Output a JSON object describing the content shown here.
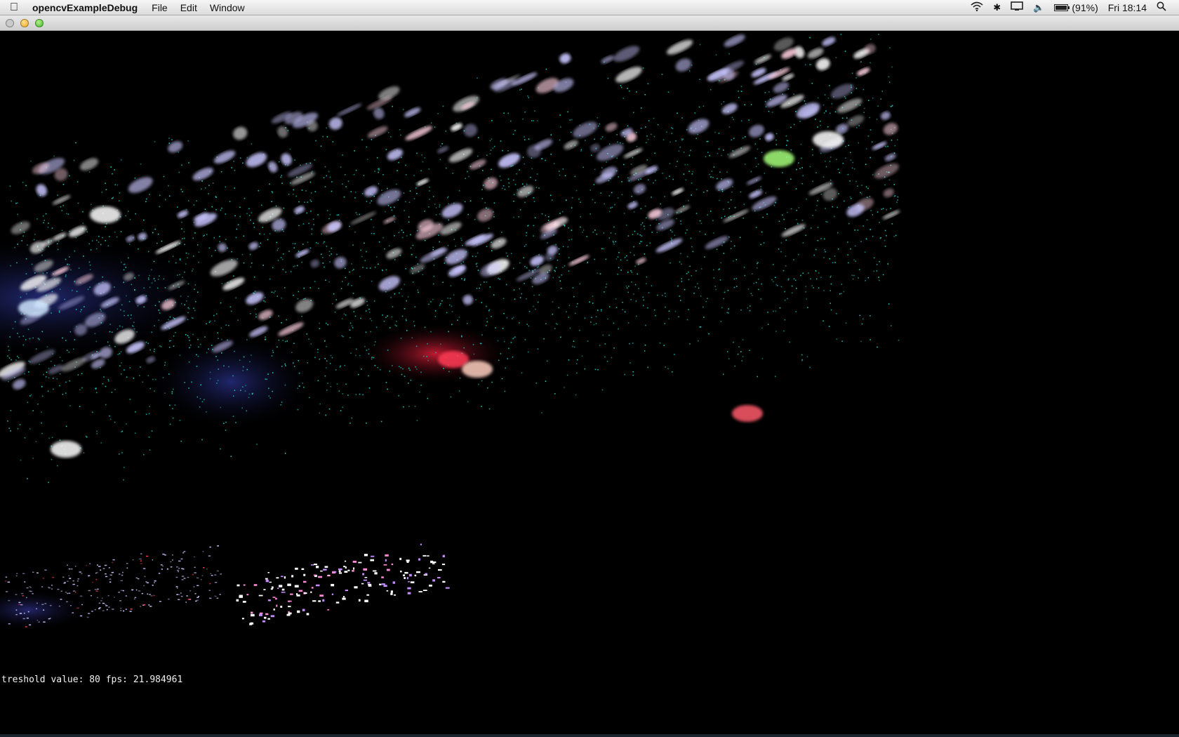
{
  "menubar": {
    "app_name": "opencvExampleDebug",
    "items": [
      "File",
      "Edit",
      "Window"
    ],
    "status": {
      "battery_percent": 91,
      "battery_label": "(91%)",
      "clock": "Fri 18:14"
    },
    "icons": [
      "apple-icon",
      "wifi-icon",
      "bluetooth-icon",
      "display-icon",
      "volume-icon",
      "battery-icon",
      "spotlight-search-icon"
    ]
  },
  "window": {
    "controls": [
      "close",
      "minimize",
      "zoom"
    ]
  },
  "overlay": {
    "status_text": "treshold value: 80 fps: 21.984961"
  },
  "colors": {
    "background": "#000000",
    "dots": "#1fc8c0",
    "blobs": "#c9c6ff",
    "red_glow": "#e0203a"
  }
}
